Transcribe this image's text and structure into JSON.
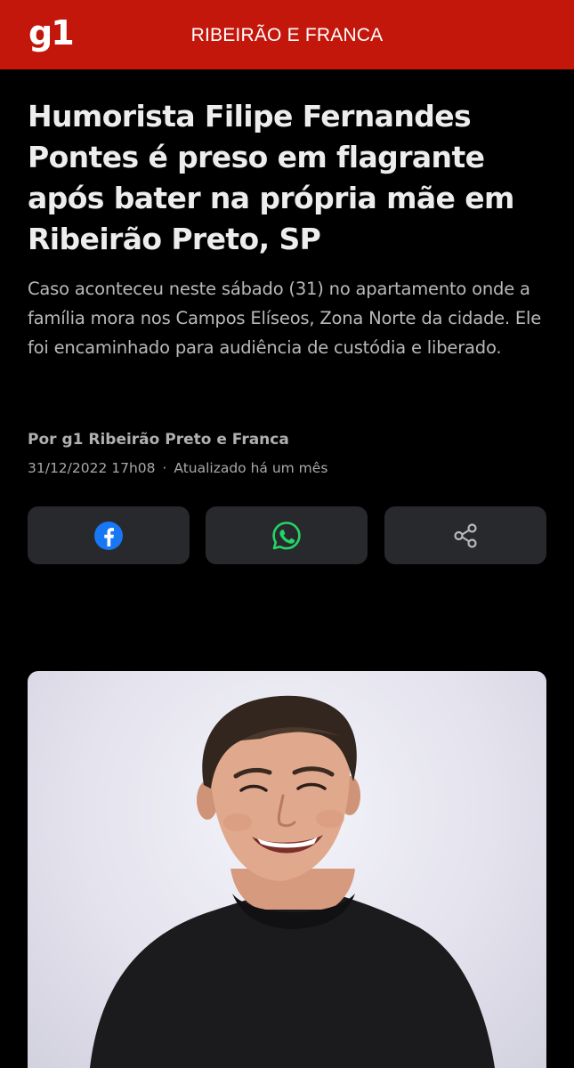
{
  "header": {
    "logo": "g1",
    "section": "RIBEIRÃO E FRANCA"
  },
  "article": {
    "headline": "Humorista Filipe Fernandes Pontes é preso em flagrante após bater na própria mãe em Ribeirão Preto, SP",
    "subtitle": "Caso aconteceu neste sábado (31) no apartamento onde a família mora nos Campos Elíseos, Zona Norte da cidade. Ele foi encaminhado para audiência de custódia e liberado.",
    "byline": "Por g1 Ribeirão Preto e Franca",
    "published": "31/12/2022 17h08",
    "separator": "·",
    "updated": "Atualizado há um mês"
  },
  "share": [
    {
      "icon": "facebook-icon",
      "color": "#1877f2"
    },
    {
      "icon": "whatsapp-icon",
      "color": "#25d366"
    },
    {
      "icon": "share-icon",
      "color": "#b8b8b8"
    }
  ],
  "colors": {
    "brand": "#c4170c",
    "background": "#000000",
    "button": "#28292d"
  }
}
